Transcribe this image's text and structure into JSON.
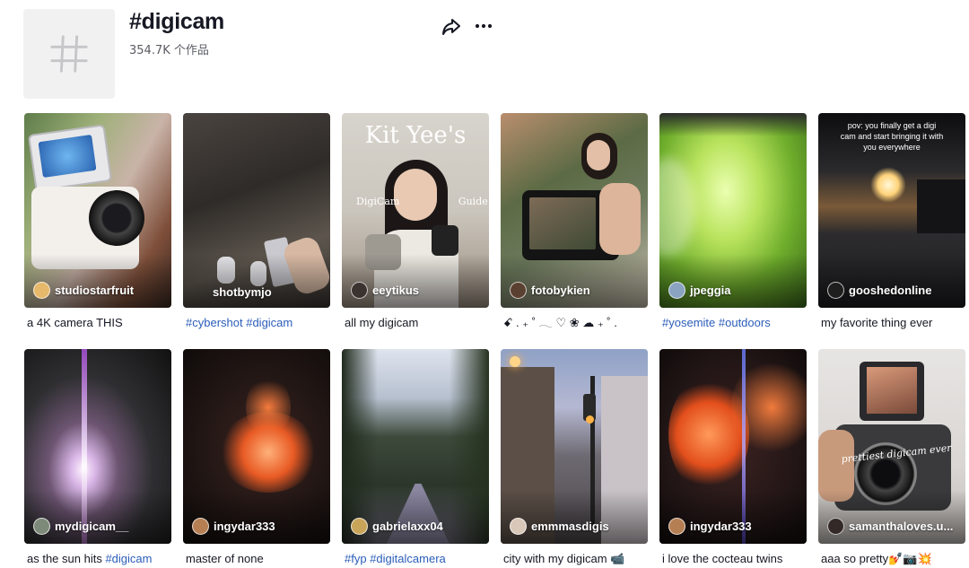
{
  "header": {
    "hashtag_title": "#digicam",
    "post_count": "354.7K 个作品",
    "hash_icon": "hash-icon",
    "share_icon": "share-arrow-icon",
    "more_icon": "more-dots-icon"
  },
  "videos": [
    {
      "author": "studiostarfruit",
      "caption_parts": [
        {
          "text": "a 4K camera THIS",
          "tag": false
        }
      ]
    },
    {
      "author": "shotbymjo",
      "caption_parts": [
        {
          "text": "#cybershot",
          "tag": true
        },
        {
          "text": " ",
          "tag": false
        },
        {
          "text": "#digicam",
          "tag": true
        }
      ]
    },
    {
      "author": "eeytikus",
      "caption_parts": [
        {
          "text": "all my digicam",
          "tag": false
        }
      ],
      "overlay": [
        "Kit Yee's",
        "DigiCam Guide"
      ]
    },
    {
      "author": "fotobykien",
      "caption_parts": [
        {
          "text": "ꗃ . ₊ ˚ 𓂃 ♡ ❀ ☁ ₊ ˚ .",
          "tag": false
        }
      ]
    },
    {
      "author": "jpeggia",
      "caption_parts": [
        {
          "text": "#yosemite",
          "tag": true
        },
        {
          "text": " ",
          "tag": false
        },
        {
          "text": "#outdoors",
          "tag": true
        }
      ]
    },
    {
      "author": "gooshedonline",
      "caption_parts": [
        {
          "text": "my favorite thing ever",
          "tag": false
        }
      ],
      "overlay": [
        "pov: you finally get a digi cam and start bringing it with you everywhere"
      ]
    },
    {
      "author": "mydigicam__",
      "caption_parts": [
        {
          "text": "as the sun hits ",
          "tag": false
        },
        {
          "text": "#digicam",
          "tag": true
        }
      ]
    },
    {
      "author": "ingydar333",
      "caption_parts": [
        {
          "text": "master of none",
          "tag": false
        }
      ]
    },
    {
      "author": "gabrielaxx04",
      "caption_parts": [
        {
          "text": "#fyp",
          "tag": true
        },
        {
          "text": " ",
          "tag": false
        },
        {
          "text": "#digitalcamera",
          "tag": true
        }
      ]
    },
    {
      "author": "emmmasdigis",
      "caption_parts": [
        {
          "text": "city with my digicam 📹",
          "tag": false
        }
      ]
    },
    {
      "author": "ingydar333",
      "caption_parts": [
        {
          "text": "i love the cocteau twins",
          "tag": false
        }
      ]
    },
    {
      "author": "samanthaloves.u...",
      "caption_parts": [
        {
          "text": "aaa so pretty💅📷💥",
          "tag": false
        }
      ],
      "overlay": [
        "prettiest digicam ever"
      ]
    }
  ],
  "colors": {
    "hashtag_link": "#2b5db9",
    "text_primary": "#161823",
    "text_secondary": "#5b5c63",
    "placeholder_bg": "#f1f1f2"
  }
}
